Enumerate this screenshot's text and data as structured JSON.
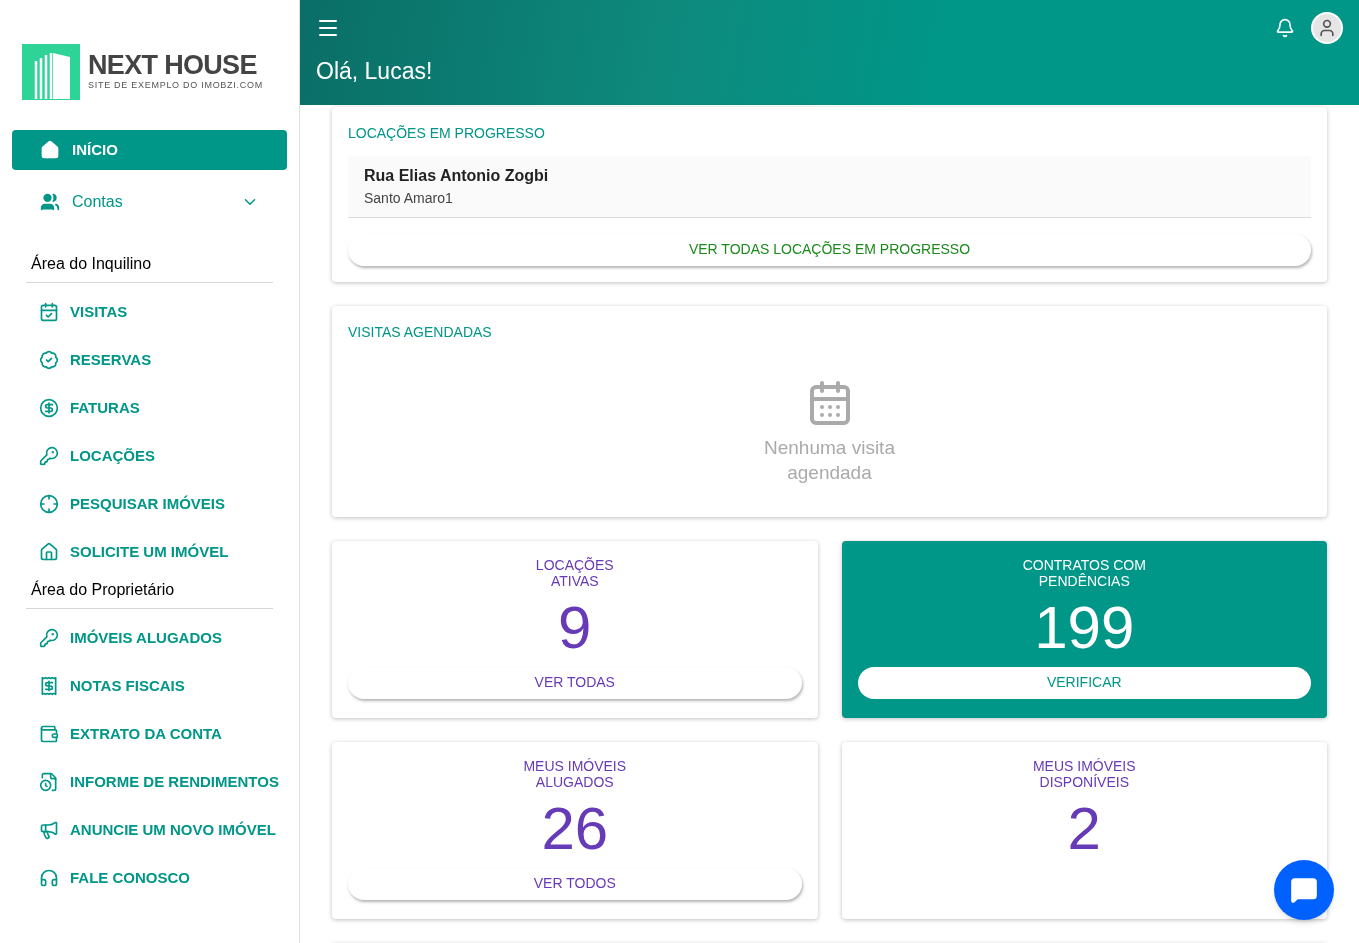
{
  "brand": {
    "name": "NEXT HOUSE",
    "tagline": "SITE DE EXEMPLO DO IMOBZI.COM"
  },
  "sidebar": {
    "items": [
      {
        "label": "INÍCIO",
        "selected": true
      },
      {
        "label": "Contas",
        "selected": false,
        "expanded": false
      }
    ],
    "sections": [
      {
        "title": "Área do Inquilino",
        "items": [
          {
            "label": "VISITAS"
          },
          {
            "label": "RESERVAS"
          },
          {
            "label": "FATURAS"
          },
          {
            "label": "LOCAÇÕES"
          },
          {
            "label": "PESQUISAR IMÓVEIS"
          },
          {
            "label": "SOLICITE UM IMÓVEL"
          }
        ]
      },
      {
        "title": "Área do Proprietário",
        "items": [
          {
            "label": "IMÓVEIS ALUGADOS"
          },
          {
            "label": "NOTAS FISCAIS"
          },
          {
            "label": "EXTRATO DA CONTA"
          },
          {
            "label": "INFORME DE RENDIMENTOS"
          },
          {
            "label": "ANUNCIE UM NOVO IMÓVEL"
          },
          {
            "label": "FALE CONOSCO"
          }
        ]
      }
    ]
  },
  "header": {
    "greeting": "Olá, Lucas!"
  },
  "rentals_in_progress": {
    "title": "LOCAÇÕES EM PROGRESSO",
    "items": [
      {
        "street": "Rua Elias Antonio Zogbi",
        "district": "Santo Amaro1"
      }
    ],
    "button": "VER TODAS LOCAÇÕES EM PROGRESSO"
  },
  "scheduled_visits": {
    "title": "VISITAS AGENDADAS",
    "empty_lines": [
      "Nenhuma visita",
      "agendada"
    ]
  },
  "stats": [
    {
      "kind": "plain",
      "title_lines": [
        "LOCAÇÕES",
        "ATIVAS"
      ],
      "value": "9",
      "button": "VER TODAS"
    },
    {
      "kind": "highlight",
      "title_lines": [
        "CONTRATOS COM",
        "PENDÊNCIAS"
      ],
      "value": "199",
      "button": "VERIFICAR"
    },
    {
      "kind": "plain",
      "title_lines": [
        "MEUS IMÓVEIS",
        "ALUGADOS"
      ],
      "value": "26",
      "button": "VER TODOS"
    },
    {
      "kind": "plain",
      "title_lines": [
        "MEUS IMÓVEIS",
        "DISPONÍVEIS"
      ],
      "value": "2"
    }
  ]
}
